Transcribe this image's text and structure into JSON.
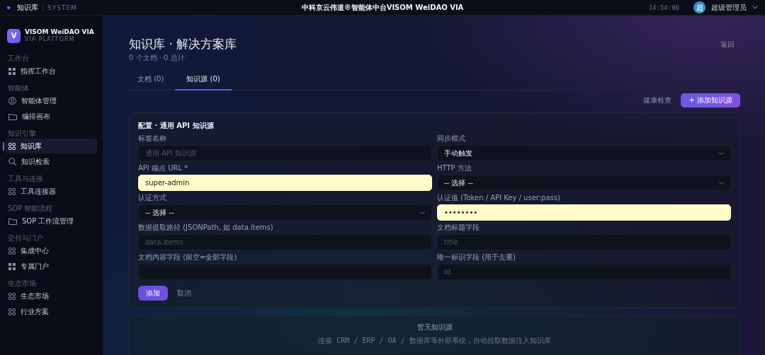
{
  "topbar": {
    "section": "知识库",
    "system": "SYSTEM",
    "title": "中科京云伟道®智能体中台VISOM WeiDAO VIA",
    "time": "14:54:00",
    "avatar": "超",
    "user": "超级管理员"
  },
  "brand": {
    "logo": "V",
    "name": "VISOM WeiDAO VIA",
    "subtitle": "VIA PLATFORM"
  },
  "sidebar": {
    "groups": [
      {
        "label": "工作台",
        "items": [
          {
            "label": "指挥工作台",
            "selected": false
          }
        ]
      },
      {
        "label": "智能体",
        "items": [
          {
            "label": "智能体管理",
            "selected": false
          },
          {
            "label": "编排画布",
            "selected": false
          }
        ]
      },
      {
        "label": "知识引擎",
        "items": [
          {
            "label": "知识库",
            "selected": true
          },
          {
            "label": "知识检索",
            "selected": false
          }
        ]
      },
      {
        "label": "工具与连接",
        "items": [
          {
            "label": "工具连接器",
            "selected": false
          }
        ]
      },
      {
        "label": "SOP 智能流程",
        "items": [
          {
            "label": "SOP 工作流管理",
            "selected": false
          }
        ]
      },
      {
        "label": "交付与门户",
        "items": [
          {
            "label": "集成中心",
            "selected": false
          },
          {
            "label": "专属门户",
            "selected": false
          }
        ]
      },
      {
        "label": "生态市场",
        "items": [
          {
            "label": "生态市场",
            "selected": false
          },
          {
            "label": "行业方案",
            "selected": false
          }
        ]
      }
    ]
  },
  "page": {
    "title": "知识库 · 解决方案库",
    "subtitle": "0 个文档 · 0 总计",
    "back": "返回"
  },
  "tabs": [
    {
      "label": "文档 (0)",
      "selected": false
    },
    {
      "label": "知识源 (0)",
      "selected": true
    }
  ],
  "actions": {
    "health": "健康检查",
    "add": "+ 添加知识源"
  },
  "form": {
    "title": "配置 · 通用 API 知识源",
    "fields": [
      {
        "kind": "input",
        "label": "标签名称",
        "placeholder": "通用 API 知识源",
        "autofilled": false
      },
      {
        "kind": "select",
        "label": "同步模式",
        "value": "手动触发",
        "autofilled": false
      },
      {
        "kind": "input",
        "label": "API 端点 URL *",
        "value": "super-admin",
        "autofilled": true
      },
      {
        "kind": "select",
        "label": "HTTP 方法",
        "value": "-- 选择 --",
        "autofilled": false
      },
      {
        "kind": "select",
        "label": "认证方式",
        "value": "-- 选择 --",
        "autofilled": false
      },
      {
        "kind": "input",
        "label": "认证值 (Token / API Key / user:pass)",
        "value": "••••••••",
        "autofilled": true
      },
      {
        "kind": "input",
        "label": "数据提取路径 (JSONPath, 如 data.items)",
        "placeholder": "data.items",
        "autofilled": false
      },
      {
        "kind": "input",
        "label": "文档标题字段",
        "placeholder": "title",
        "autofilled": false
      },
      {
        "kind": "input",
        "label": "文档内容字段 (留空=全部字段)",
        "autofilled": false
      },
      {
        "kind": "input",
        "label": "唯一标识字段 (用于去重)",
        "placeholder": "id",
        "autofilled": false
      }
    ],
    "submit": "添加",
    "cancel": "取消"
  },
  "empty": {
    "title": "暂无知识源",
    "text": "连接 CRM / ERP / OA / 数据库等外部系统，自动拉取数据注入知识库"
  }
}
